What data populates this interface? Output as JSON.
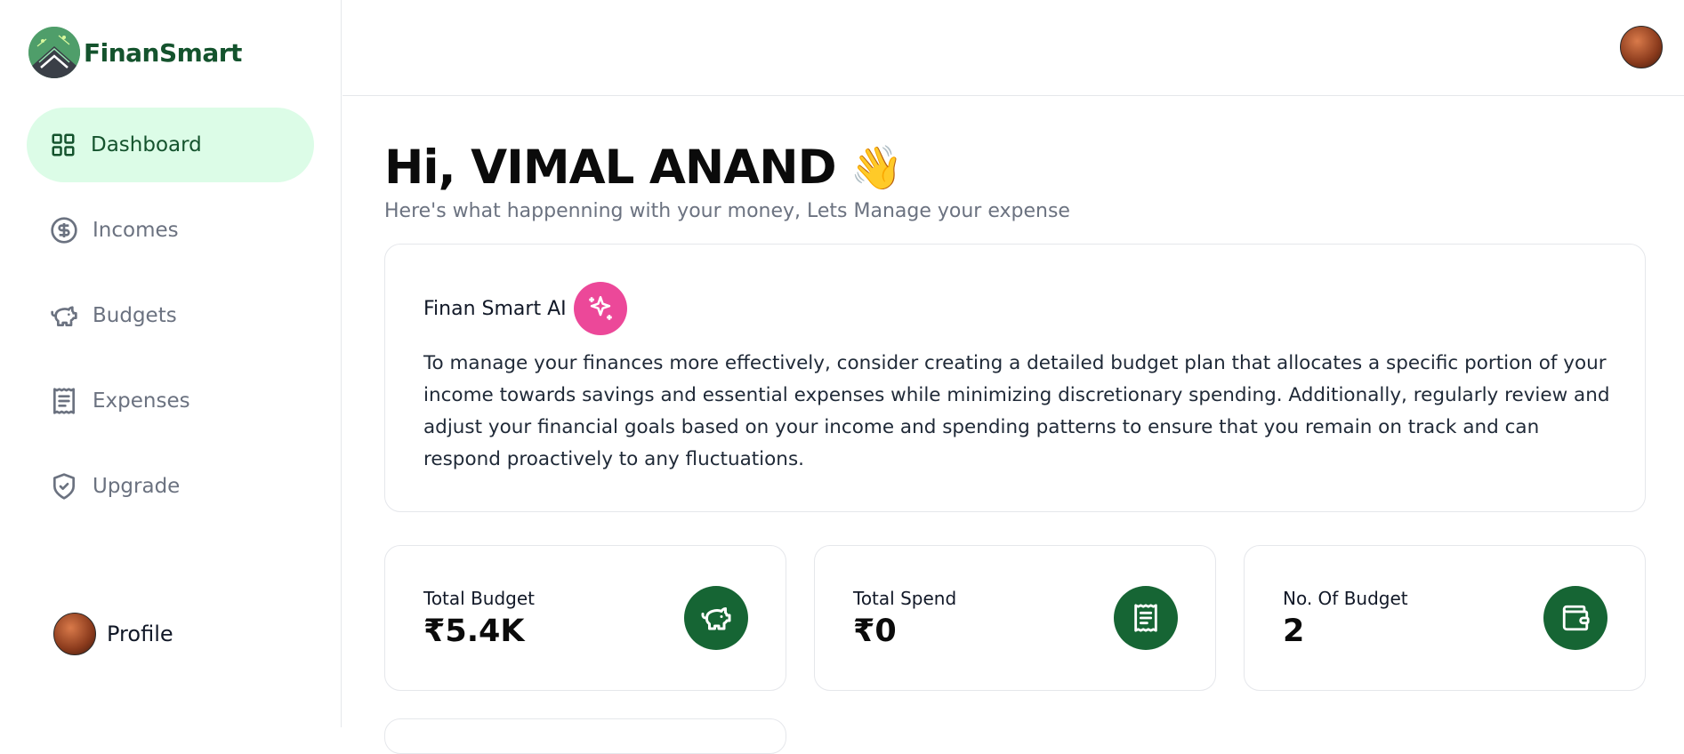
{
  "app": {
    "name": "FinanSmart"
  },
  "sidebar": {
    "items": [
      {
        "label": "Dashboard",
        "icon": "dashboard-grid-icon",
        "active": true
      },
      {
        "label": "Incomes",
        "icon": "dollar-circle-icon",
        "active": false
      },
      {
        "label": "Budgets",
        "icon": "piggy-bank-icon",
        "active": false
      },
      {
        "label": "Expenses",
        "icon": "receipt-icon",
        "active": false
      },
      {
        "label": "Upgrade",
        "icon": "shield-check-icon",
        "active": false
      }
    ],
    "profile_label": "Profile"
  },
  "header": {
    "greeting": "Hi, VIMAL ANAND",
    "wave": "👋",
    "subtitle": "Here's what happenning with your money, Lets Manage your expense"
  },
  "ai_card": {
    "title": "Finan Smart AI",
    "message": "To manage your finances more effectively, consider creating a detailed budget plan that allocates a specific portion of your income towards savings and essential expenses while minimizing discretionary spending. Additionally, regularly review and adjust your financial goals based on your income and spending patterns to ensure that you remain on track and can respond proactively to any fluctuations."
  },
  "stats": [
    {
      "label": "Total Budget",
      "value": "₹5.4K",
      "icon": "piggy-bank-icon"
    },
    {
      "label": "Total Spend",
      "value": "₹0",
      "icon": "receipt-icon"
    },
    {
      "label": "No. Of Budget",
      "value": "2",
      "icon": "wallet-icon"
    }
  ],
  "colors": {
    "brand": "#14532d",
    "active_bg": "#dcfce7",
    "icon_bg": "#166534",
    "ai_badge": "#ec4899"
  }
}
